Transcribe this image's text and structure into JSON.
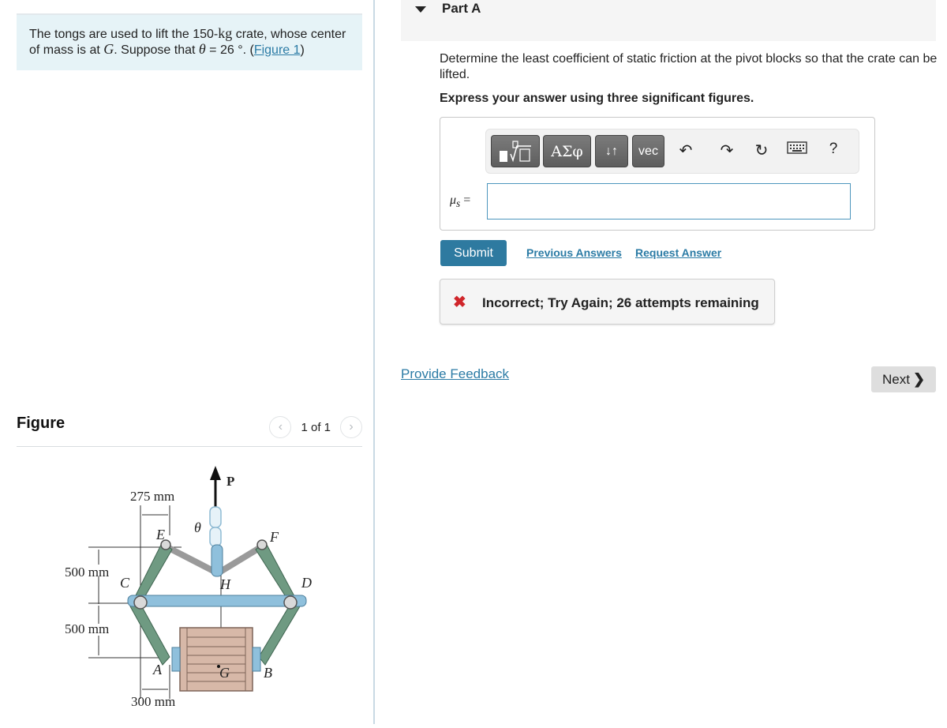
{
  "problem": {
    "text_before": "The tongs are used to lift the 150-",
    "unit": "kg",
    "text_middle": " crate, whose center of mass is at ",
    "point": "G",
    "text_after": ". Suppose that ",
    "theta_symbol": "θ",
    "theta_value": " = 26 °. (",
    "figure_link": "Figure 1",
    "close_paren": ")"
  },
  "figure_panel": {
    "title": "Figure",
    "pager_text": "1 of 1",
    "prev_icon": "chevron-left-icon",
    "next_icon": "chevron-right-icon"
  },
  "figure": {
    "dim_top": "275 mm",
    "dim_left_upper": "500 mm",
    "dim_left_lower": "500 mm",
    "dim_bottom": "300 mm",
    "force_label": "P",
    "angle_label": "θ",
    "points": {
      "E": "E",
      "F": "F",
      "C": "C",
      "D": "D",
      "H": "H",
      "A": "A",
      "B": "B",
      "G": "G"
    },
    "colors": {
      "arm": "#6f9a82",
      "bar": "#8fc0dc",
      "crate": "#d7b8a8",
      "crate_dark": "#b7968a"
    }
  },
  "part": {
    "title": "Part A",
    "question": "Determine the least coefficient of static friction at the pivot blocks so that the crate can be lifted.",
    "instruction": "Express your answer using three significant figures."
  },
  "toolbar": {
    "templates_icon": "templates-sqrt-icon",
    "greek_label": "ΑΣφ",
    "arrows_label": "↓↑",
    "vec_label": "vec",
    "undo_icon": "undo-icon",
    "redo_icon": "redo-icon",
    "reset_icon": "reset-icon",
    "keyboard_icon": "keyboard-icon",
    "help_label": "?"
  },
  "answer": {
    "variable": "μ",
    "subscript": "s",
    "equals": " =",
    "value": "",
    "placeholder": ""
  },
  "actions": {
    "submit_label": "Submit",
    "previous_answers_label": "Previous Answers",
    "request_answer_label": "Request Answer"
  },
  "feedback": {
    "icon": "x-icon",
    "message": "Incorrect; Try Again; 26 attempts remaining",
    "color": "#d0262b"
  },
  "footer": {
    "provide_feedback_label": "Provide Feedback",
    "next_label": "Next",
    "next_chevron": "❯"
  }
}
